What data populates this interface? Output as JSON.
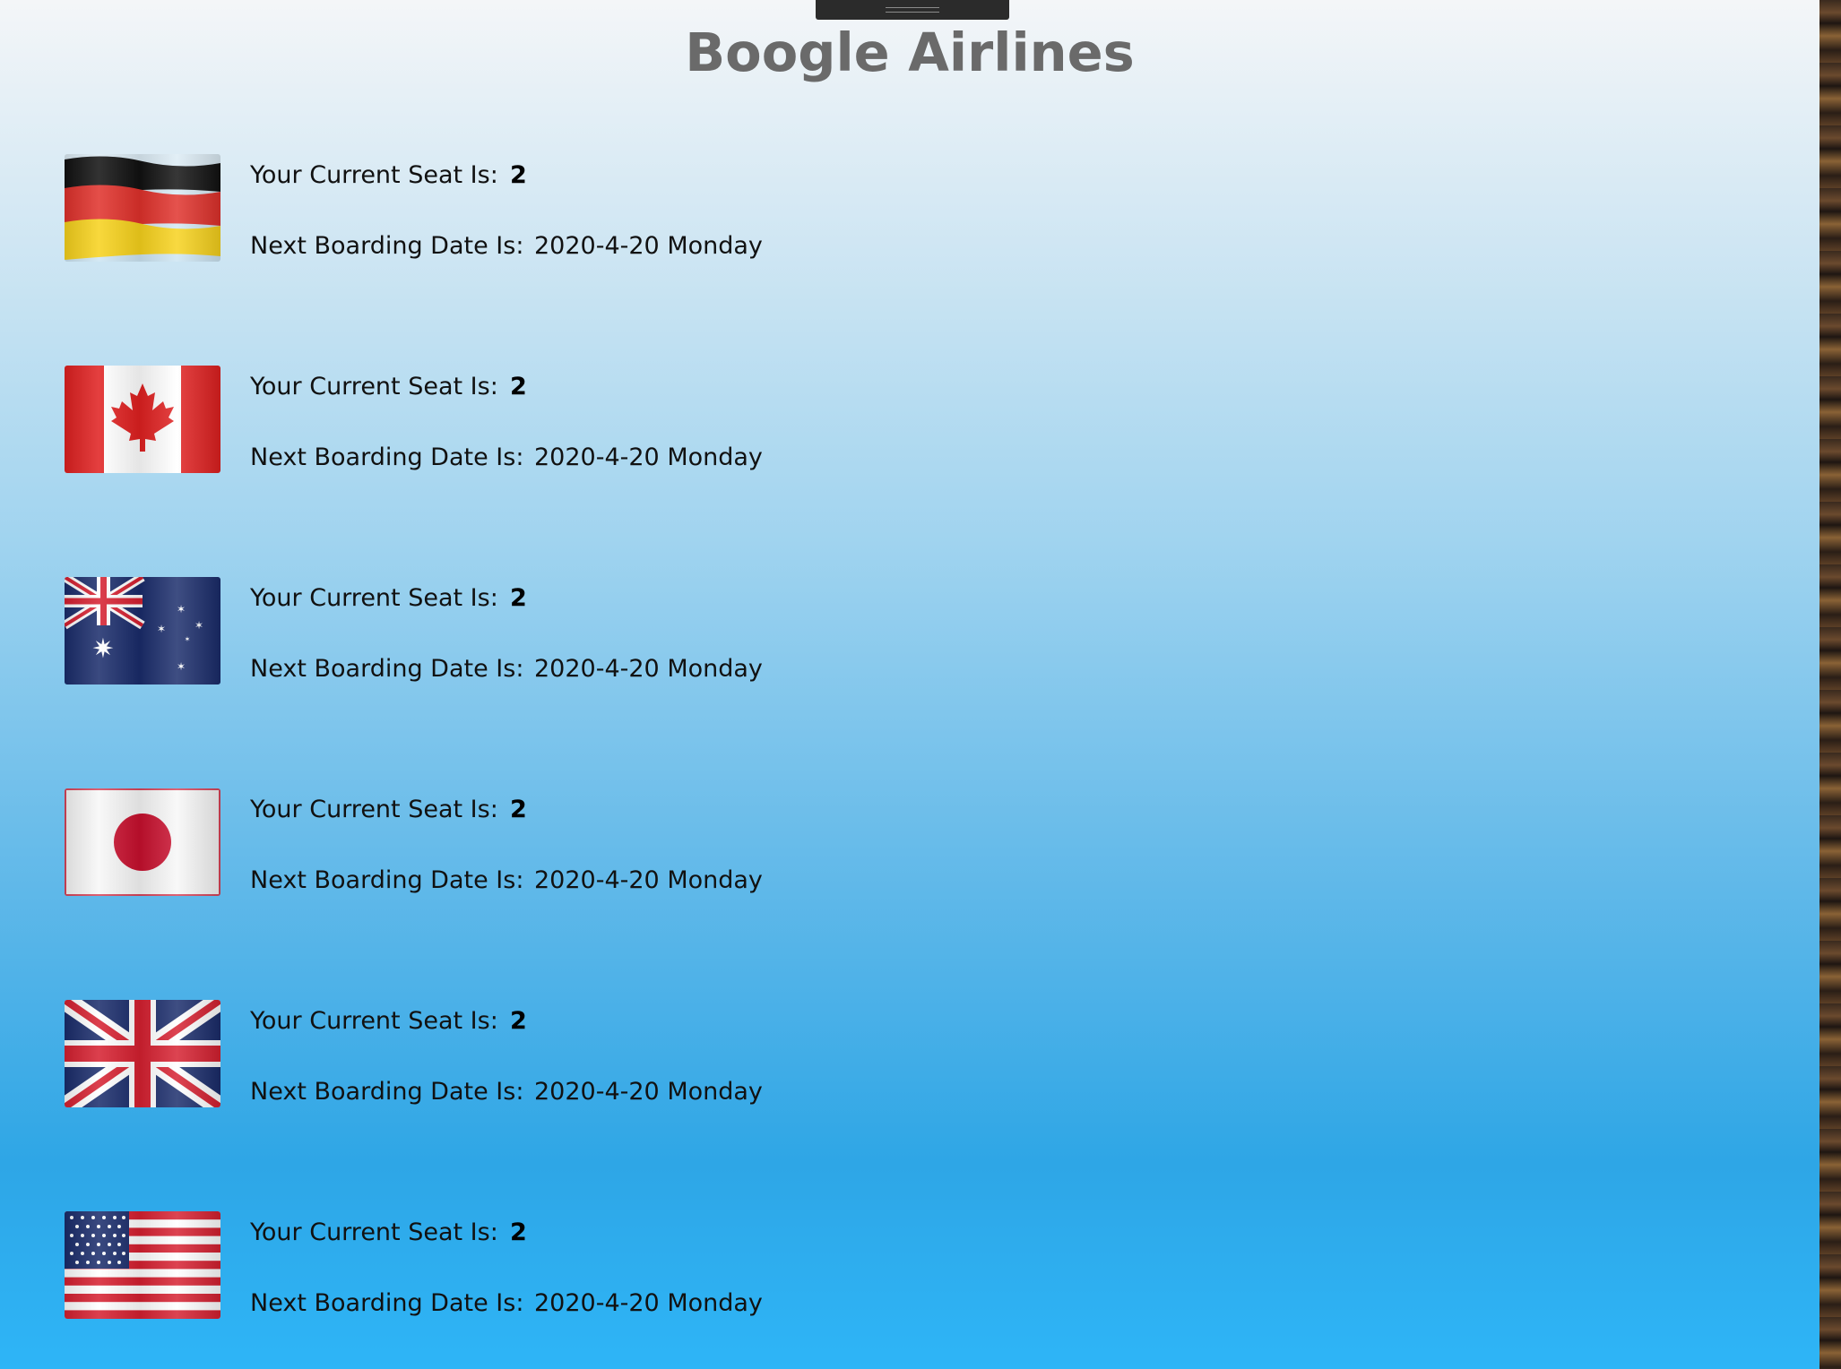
{
  "app": {
    "title": "Boogle Airlines"
  },
  "labels": {
    "seat": "Your Current Seat Is:",
    "date": "Next Boarding Date Is:"
  },
  "flights": [
    {
      "flag_icon": "germany-flag-icon",
      "seat": "2",
      "date": "2020-4-20 Monday"
    },
    {
      "flag_icon": "canada-flag-icon",
      "seat": "2",
      "date": "2020-4-20 Monday"
    },
    {
      "flag_icon": "australia-flag-icon",
      "seat": "2",
      "date": "2020-4-20 Monday"
    },
    {
      "flag_icon": "japan-flag-icon",
      "seat": "2",
      "date": "2020-4-20 Monday"
    },
    {
      "flag_icon": "uk-flag-icon",
      "seat": "2",
      "date": "2020-4-20 Monday"
    },
    {
      "flag_icon": "usa-flag-icon",
      "seat": "2",
      "date": "2020-4-20 Monday"
    }
  ],
  "colors": {
    "title": "#6a6a6a",
    "background_top": "#f4f6f8",
    "background_bottom": "#2eb5f7"
  }
}
